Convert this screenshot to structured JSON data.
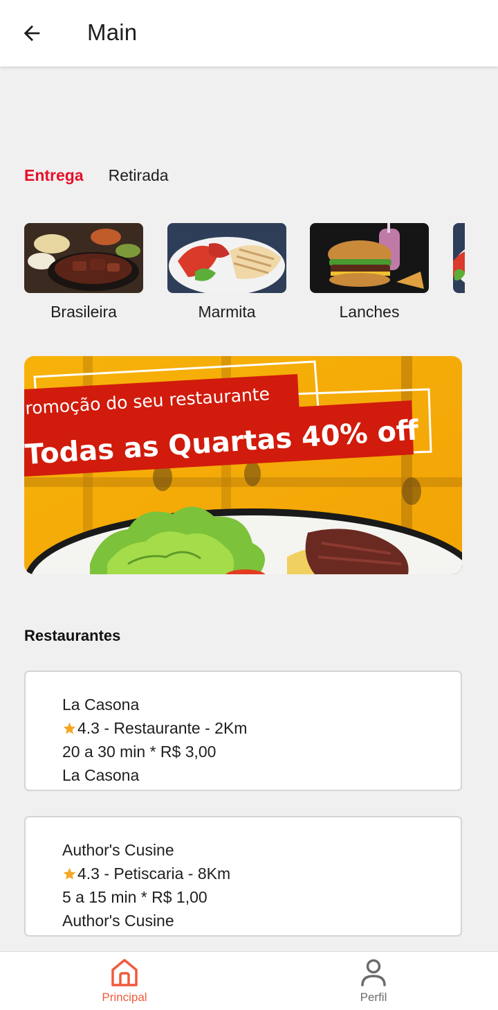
{
  "header": {
    "title": "Main",
    "back_icon": "arrow-left-icon"
  },
  "tabs": [
    {
      "label": "Entrega",
      "active": true
    },
    {
      "label": "Retirada",
      "active": false
    }
  ],
  "categories": [
    {
      "label": "Brasileira"
    },
    {
      "label": "Marmita"
    },
    {
      "label": "Lanches"
    }
  ],
  "banner": {
    "line1": "romoção do seu restaurante",
    "line2": "Todas as Quartas 40% off"
  },
  "restaurants_section": {
    "title": "Restaurantes"
  },
  "restaurants": [
    {
      "name": "La Casona",
      "rating_line": "4.3 - Restaurante - 2Km",
      "delivery_line": "20 a 30 min * R$ 3,00",
      "subtitle": "La Casona"
    },
    {
      "name": "Author's Cusine",
      "rating_line": "4.3 - Petiscaria - 8Km",
      "delivery_line": "5 a 15 min * R$ 1,00",
      "subtitle": "Author's Cusine"
    }
  ],
  "bottom_nav": [
    {
      "label": "Principal",
      "icon": "home-icon",
      "active": true
    },
    {
      "label": "Perfil",
      "icon": "person-icon",
      "active": false
    }
  ],
  "colors": {
    "accent": "#e5102a",
    "nav_active": "#f05a3c",
    "nav_inactive": "#6b6b6b",
    "star": "#f5a623"
  }
}
